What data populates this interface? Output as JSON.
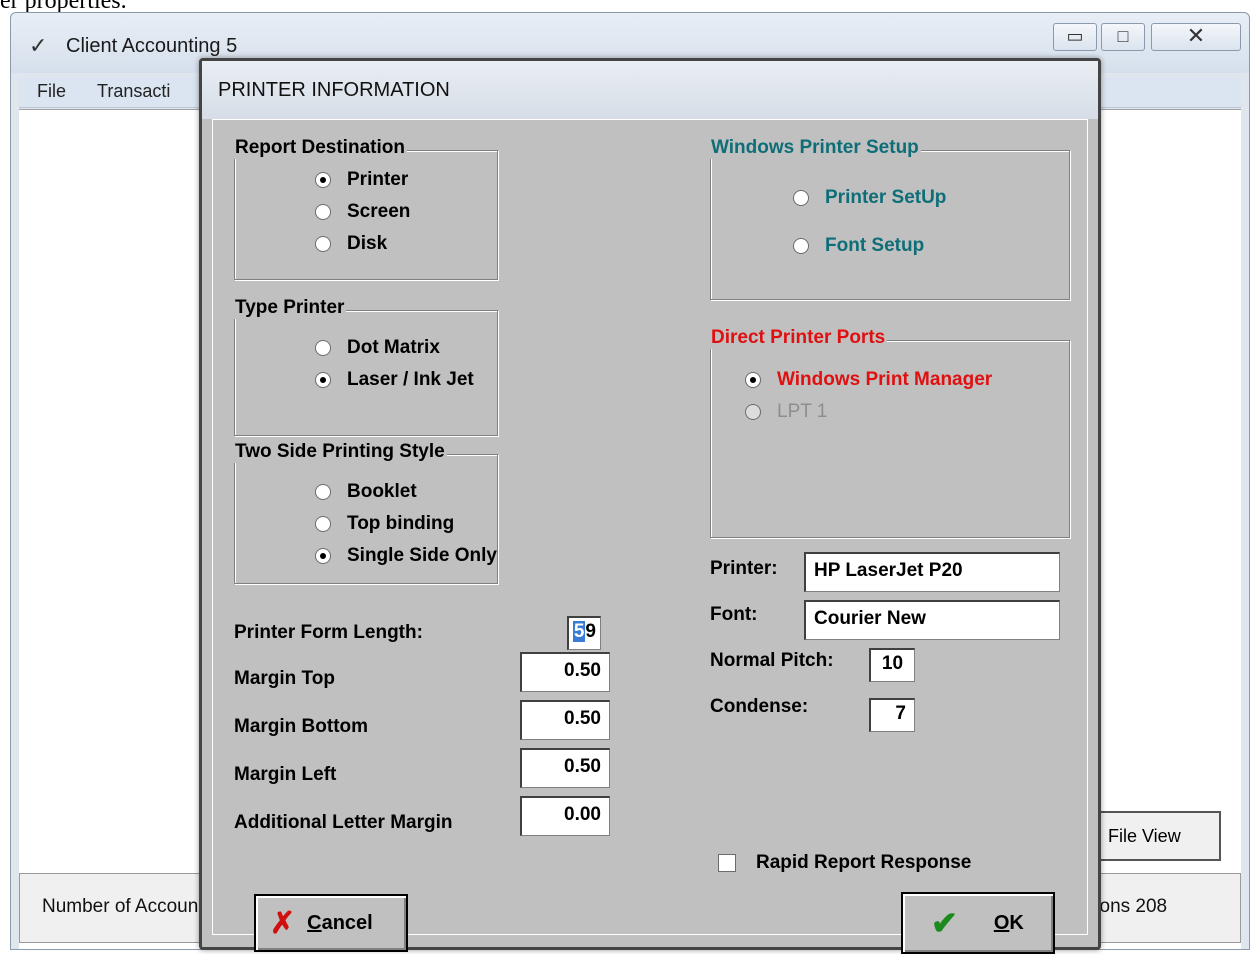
{
  "caption": "er properties.",
  "window": {
    "title": "Client Accounting 5",
    "menu": [
      "File",
      "Transacti"
    ],
    "file_view_label": "File View",
    "status_left": "Number of Accoun",
    "status_right": "tions 208"
  },
  "dialog": {
    "title": "PRINTER INFORMATION",
    "report_destination": {
      "title": "Report Destination",
      "options": [
        "Printer",
        "Screen",
        "Disk"
      ],
      "selected": "Printer"
    },
    "type_printer": {
      "title": "Type Printer",
      "options": [
        "Dot Matrix",
        "Laser / Ink Jet"
      ],
      "selected": "Laser / Ink Jet"
    },
    "two_side": {
      "title": "Two Side Printing Style",
      "options": [
        "Booklet",
        "Top binding",
        "Single Side Only"
      ],
      "selected": "Single Side Only"
    },
    "windows_printer_setup": {
      "title": "Windows Printer Setup",
      "options": [
        "Printer SetUp",
        "Font Setup"
      ]
    },
    "direct_ports": {
      "title": "Direct Printer Ports",
      "options": [
        "Windows Print Manager",
        "LPT 1"
      ],
      "selected": "Windows Print Manager"
    },
    "fields": {
      "form_length_label": "Printer Form Length:",
      "form_length_value_sel": "5",
      "form_length_value_rest": "9",
      "margin_top_label": "Margin Top",
      "margin_top_value": "0.50",
      "margin_bottom_label": "Margin Bottom",
      "margin_bottom_value": "0.50",
      "margin_left_label": "Margin Left",
      "margin_left_value": "0.50",
      "additional_label": "Additional Letter Margin",
      "additional_value": "0.00",
      "printer_label": "Printer:",
      "printer_value": "HP LaserJet P20",
      "font_label": "Font:",
      "font_value": "Courier New",
      "normal_pitch_label": "Normal Pitch:",
      "normal_pitch_value": "10",
      "condense_label": "Condense:",
      "condense_value": "7"
    },
    "rapid_report_label": "Rapid Report Response",
    "cancel_mnemonic": "C",
    "cancel_rest": "ancel",
    "ok_mnemonic": "O",
    "ok_rest": "K"
  },
  "colors": {
    "teal_text": "#0e6e78",
    "red_text": "#e01010",
    "dialog_bg": "#c0c0c0"
  }
}
